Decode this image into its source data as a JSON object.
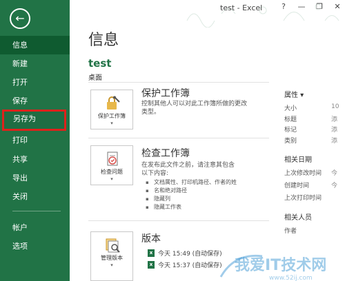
{
  "window": {
    "title": "test - Excel",
    "controls": [
      "?",
      "—",
      "❐",
      "✕"
    ]
  },
  "sidebar": {
    "back_glyph": "←",
    "items": [
      {
        "label": "信息"
      },
      {
        "label": "新建"
      },
      {
        "label": "打开"
      },
      {
        "label": "保存"
      },
      {
        "label": "另存为"
      },
      {
        "label": "打印"
      },
      {
        "label": "共享"
      },
      {
        "label": "导出"
      },
      {
        "label": "关闭"
      },
      {
        "label": "帐户"
      },
      {
        "label": "选项"
      }
    ]
  },
  "main": {
    "title": "信息",
    "file_name": "test",
    "file_location": "桌面",
    "protect": {
      "button_label": "保护工作簿",
      "title": "保护工作簿",
      "description": [
        "控制其他人可以对此工作簿所做的更改",
        "类型。"
      ]
    },
    "inspect": {
      "button_label": "检查问题",
      "title": "检查工作簿",
      "description": [
        "在发布此文件之前，请注意其包含",
        "以下内容:"
      ],
      "bullets": [
        "文档属性、打印机路径、作者的姓",
        "名和绝对路径",
        "隐藏列",
        "隐藏工作表"
      ]
    },
    "versions": {
      "button_label": "管理版本",
      "title": "版本",
      "items": [
        "今天 15:49 (自动保存)",
        "今天 15:37 (自动保存)"
      ]
    }
  },
  "properties": {
    "header": "属性",
    "rows": [
      {
        "label": "大小",
        "value": "10"
      },
      {
        "label": "标题",
        "value": "添"
      },
      {
        "label": "标记",
        "value": "添"
      },
      {
        "label": "类别",
        "value": "添"
      }
    ],
    "dates_header": "相关日期",
    "dates": [
      {
        "label": "上次修改时间",
        "value": "今"
      },
      {
        "label": "创建时间",
        "value": "今"
      },
      {
        "label": "上次打印时间",
        "value": ""
      }
    ],
    "people_header": "相关人员",
    "people": [
      {
        "label": "作者",
        "value": ""
      }
    ]
  },
  "colors": {
    "sidebar": "#217346",
    "active": "#0f5b30",
    "highlight_border": "#e0211b",
    "accent_text": "#217346"
  }
}
